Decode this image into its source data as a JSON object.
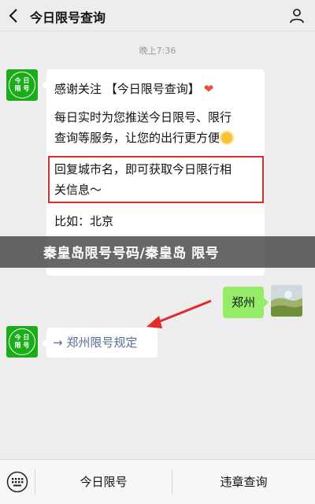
{
  "header": {
    "title": "今日限号查询"
  },
  "chat": {
    "timestamp": "晚上7:36",
    "account_avatar": {
      "line1": "今 日",
      "line2": "限 号"
    },
    "welcome": {
      "line1": "感谢关注 【今日限号查询】",
      "line1_emoji": "❤",
      "para2_line1": "每日实时为您推送今日限号、限行",
      "para2_line2": "查询等服务，让您的出行更方便",
      "para3_line1": "回复城市名，即可获取今日限行相",
      "para3_line2": "关信息～",
      "line4": "比如：北京"
    },
    "user_message": "郑州",
    "reply_link": "→ 郑州限号规定"
  },
  "banner": {
    "text": "秦皇岛限号号码/秦皇岛 限号"
  },
  "bottom_menu": {
    "item1": "今日限号",
    "item2": "违章查询"
  },
  "colors": {
    "accent_green": "#1aad19",
    "user_bubble": "#95ec69",
    "highlight_red": "#e32b2b",
    "link_blue": "#576b95"
  }
}
